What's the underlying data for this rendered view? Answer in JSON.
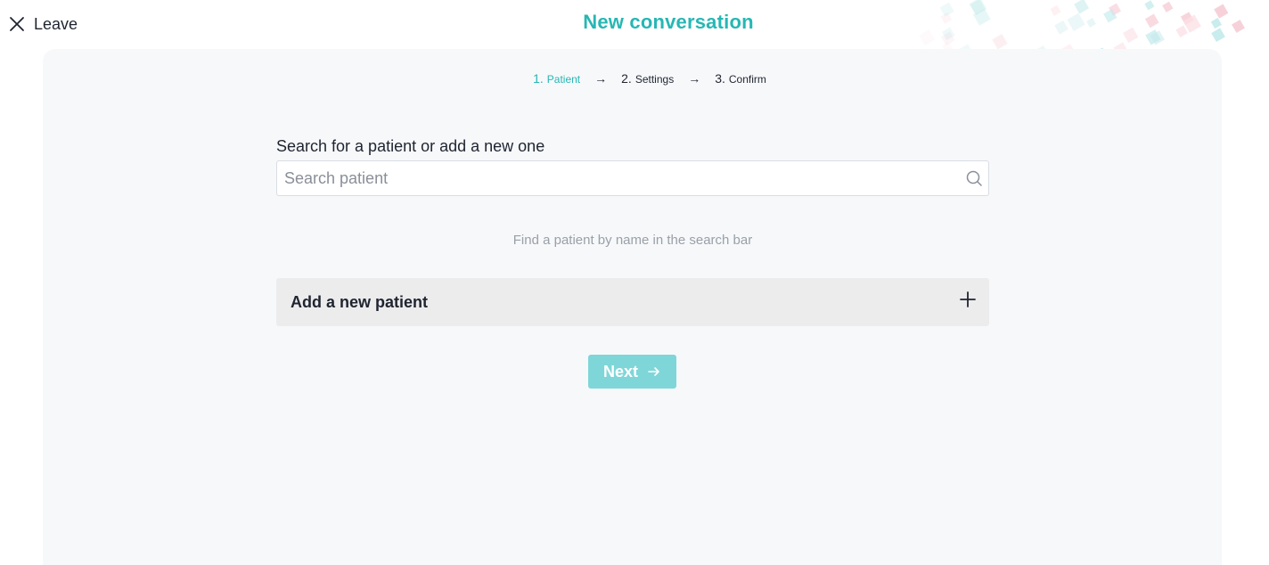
{
  "header": {
    "leave_label": "Leave",
    "title": "New conversation"
  },
  "steps": [
    {
      "num": "1.",
      "label": "Patient",
      "active": true
    },
    {
      "num": "2.",
      "label": "Settings",
      "active": false
    },
    {
      "num": "3.",
      "label": "Confirm",
      "active": false
    }
  ],
  "step_arrow": "→",
  "search": {
    "label": "Search for a patient or add a new one",
    "placeholder": "Search patient",
    "value": ""
  },
  "hint": "Find a patient by name in the search bar",
  "add_patient": {
    "label": "Add a new patient"
  },
  "next_button": {
    "label": "Next"
  },
  "colors": {
    "accent": "#26b7b4",
    "button_disabled": "#7fd6d8",
    "card_bg": "#f7f8fa",
    "add_bg": "#ececed"
  },
  "icons": {
    "leave": "close-icon",
    "search": "search-icon",
    "add": "plus-icon",
    "next": "arrow-right-icon"
  }
}
